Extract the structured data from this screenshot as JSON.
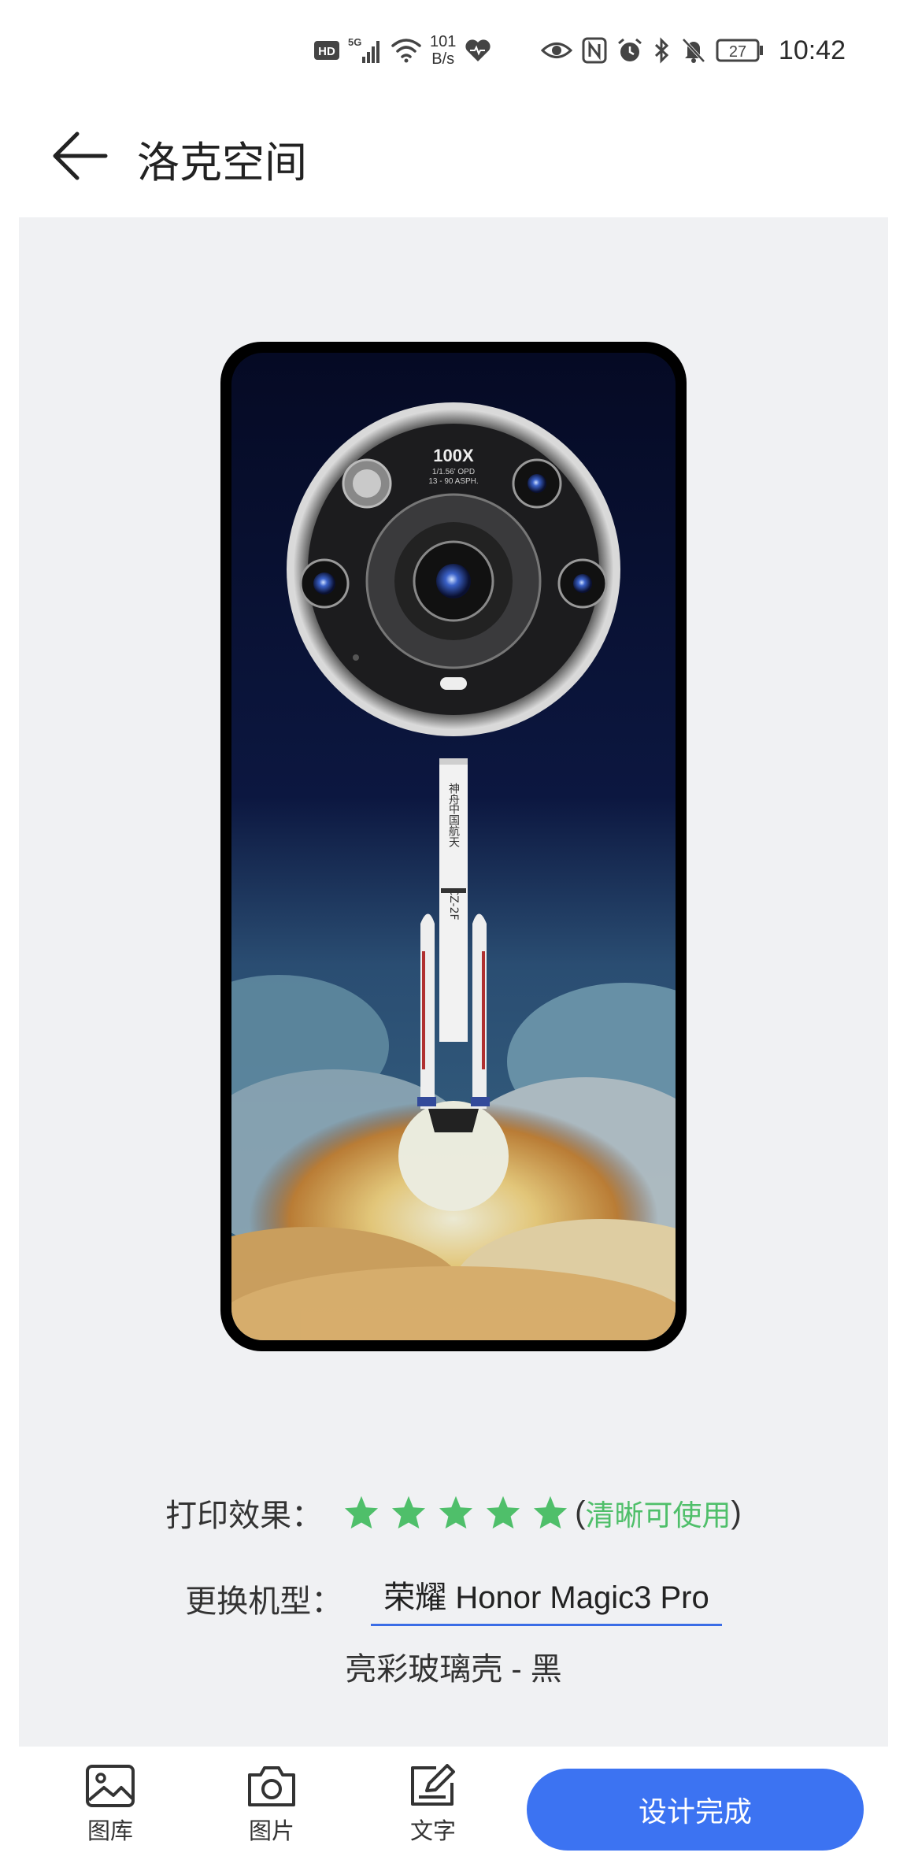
{
  "status_bar": {
    "hd": "HD",
    "network": "5G",
    "speed_value": "101",
    "speed_unit": "B/s",
    "battery": "27",
    "time": "10:42"
  },
  "header": {
    "title": "洛克空间"
  },
  "phone_preview": {
    "camera_text_main": "100X",
    "camera_text_sub1": "1/1.56' OPD",
    "camera_text_sub2": "13 - 90 ASPH.",
    "rocket_text_top": "神舟",
    "rocket_text_brand": "中国航天",
    "rocket_text_model": "CZ-2F"
  },
  "info": {
    "print_label": "打印效果：",
    "rating": 5,
    "rating_max": 5,
    "paren_open": "(",
    "quality_text": "清晰可使用",
    "paren_close": ")",
    "model_label": "更换机型：",
    "model_value": "荣耀 Honor Magic3 Pro",
    "material": "亮彩玻璃壳 - 黑"
  },
  "toolbar": {
    "gallery_label": "图库",
    "photo_label": "图片",
    "text_label": "文字",
    "done_label": "设计完成"
  },
  "colors": {
    "accent": "#3c73f2",
    "star_green": "#4fbf6a",
    "preview_bg": "#f0f1f3"
  }
}
